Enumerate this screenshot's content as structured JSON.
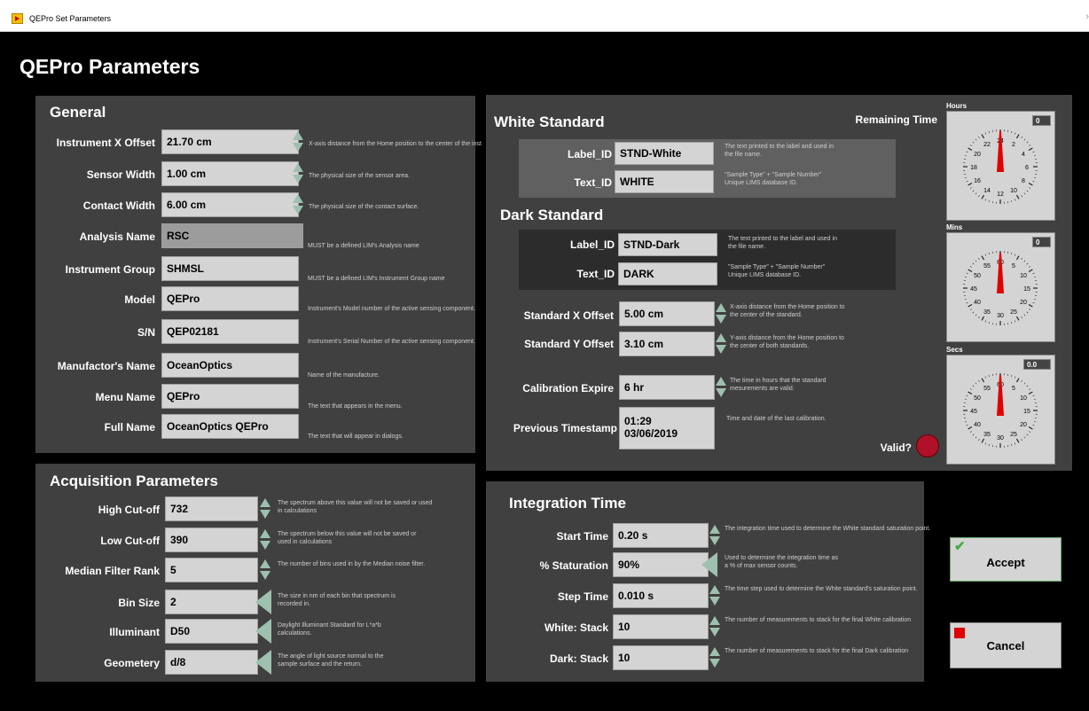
{
  "window": {
    "title": "QEPro Set Parameters",
    "chevron": "›"
  },
  "page_title": "QEPro Parameters",
  "general": {
    "title": "General",
    "fields": [
      {
        "label": "Instrument X Offset",
        "value": "21.70 cm",
        "desc": "X-axis distance from the Home position to the center of the inst"
      },
      {
        "label": "Sensor Width",
        "value": "1.00 cm",
        "desc": "The physical size of the sensor area."
      },
      {
        "label": "Contact Width",
        "value": "6.00 cm",
        "desc": "The physical size of the contact surface."
      },
      {
        "label": "Analysis Name",
        "value": "RSC",
        "desc": "MUST be a defined LIM's Analysis name"
      },
      {
        "label": "Instrument Group",
        "value": "SHMSL",
        "desc": "MUST be a defined LIM's Instrument Group name"
      },
      {
        "label": "Model",
        "value": "QEPro",
        "desc": "Instrument's Model number of the active sensing component."
      },
      {
        "label": "S/N",
        "value": "QEP02181",
        "desc": "Instrument's Serial Number of the active sensing component."
      },
      {
        "label": "Manufactor's Name",
        "value": "OceanOptics",
        "desc": "Name of the manufacture."
      },
      {
        "label": "Menu Name",
        "value": "QEPro",
        "desc": "The text that appears in the menu."
      },
      {
        "label": "Full Name",
        "value": "OceanOptics QEPro",
        "desc": "The text that will appear in dialogs."
      }
    ]
  },
  "acquisition": {
    "title": "Acquisition Parameters",
    "fields": [
      {
        "label": "High Cut-off",
        "value": "732",
        "desc1": "The spectrum above this value will not be saved or used",
        "desc2": "in calculations"
      },
      {
        "label": "Low Cut-off",
        "value": "390",
        "desc1": "The spectrum below this value will not be saved or",
        "desc2": "used in calculations"
      },
      {
        "label": "Median Filter Rank",
        "value": "5",
        "desc1": "The number of bins used in by the  Median noise filter.",
        "desc2": ""
      },
      {
        "label": "Bin Size",
        "value": "2",
        "desc1": "The size in nm of each bin that spectrum is",
        "desc2": "recorded in."
      },
      {
        "label": "Illuminant",
        "value": "D50",
        "desc1": "Daylight Illuminant Standard for L*a*b",
        "desc2": "calculations."
      },
      {
        "label": "Geometery",
        "value": "d/8",
        "desc1": "The angle of light source normal to the",
        "desc2": "sample surface and the return."
      }
    ]
  },
  "standards": {
    "white_title": "White Standard",
    "dark_title": "Dark Standard",
    "remaining_time": "Remaining Time",
    "white": {
      "label_id_label": "Label_ID",
      "label_id": "STND-White",
      "label_desc1": "The text printed to the label and used in",
      "label_desc2": "the file name.",
      "text_id_label": "Text_ID",
      "text_id": "WHITE",
      "text_desc1": "\"Sample Type\" + \"Sample Number\"",
      "text_desc2": "Unique LIMS database ID."
    },
    "dark": {
      "label_id_label": "Label_ID",
      "label_id": "STND-Dark",
      "label_desc1": "The text printed to the label and used in",
      "label_desc2": "the file name.",
      "text_id_label": "Text_ID",
      "text_id": "DARK",
      "text_desc1": "\"Sample Type\" + \"Sample Number\"",
      "text_desc2": "Unique LIMS database ID."
    },
    "std_x": {
      "label": "Standard X Offset",
      "value": "5.00 cm",
      "desc1": "X-axis distance from the Home position to",
      "desc2": "the center of the standard."
    },
    "std_y": {
      "label": "Standard Y Offset",
      "value": "3.10 cm",
      "desc1": "Y-axis distance from the Home position to",
      "desc2": "the center of both standards."
    },
    "cal_expire": {
      "label": "Calibration Expire",
      "value": "6 hr",
      "desc1": "The time in hours that the standard",
      "desc2": "mesurements are valid."
    },
    "prev_ts": {
      "label": "Previous Timestamp",
      "time": "01:29",
      "date": "03/06/2019",
      "desc": "Time and date of the last calibration."
    },
    "valid_label": "Valid?",
    "valid_color": "#b0102a"
  },
  "timers": {
    "hours": {
      "label": "Hours",
      "value": "0",
      "ticks": [
        "2",
        "4",
        "6",
        "8",
        "10",
        "12",
        "14",
        "16",
        "18",
        "20",
        "22",
        "24"
      ]
    },
    "mins": {
      "label": "Mins",
      "value": "0",
      "ticks": [
        "5",
        "10",
        "15",
        "20",
        "25",
        "30",
        "35",
        "40",
        "45",
        "50",
        "55",
        "60"
      ]
    },
    "secs": {
      "label": "Secs",
      "value": "0.0",
      "ticks": [
        "5",
        "10",
        "15",
        "20",
        "25",
        "30",
        "35",
        "40",
        "45",
        "50",
        "55",
        "60"
      ]
    }
  },
  "integration": {
    "title": "Integration Time",
    "fields": [
      {
        "label": "Start Time",
        "value": "0.20 s",
        "desc1": "The integration time used to determine the White standard saturation point.",
        "desc2": ""
      },
      {
        "label": "% Staturation",
        "value": "90%",
        "desc1": "Used to determine the integration time as",
        "desc2": "a % of max sensor  counts."
      },
      {
        "label": "Step Time",
        "value": "0.010 s",
        "desc1": "The time step used to determine the White standard's saturation point.",
        "desc2": ""
      },
      {
        "label": "White: Stack",
        "value": "10",
        "desc1": "The number of measurements to stack for the final White calibration",
        "desc2": ""
      },
      {
        "label": "Dark: Stack",
        "value": "10",
        "desc1": "The number of measurements to stack for the final Dark calibration",
        "desc2": ""
      }
    ]
  },
  "buttons": {
    "accept": "Accept",
    "cancel": "Cancel"
  },
  "colors": {
    "background": "#000000",
    "panel": "#404040",
    "field": "#d4d4d4",
    "gauge_needle": "#e00000",
    "spin_arrow": "#9ec0ae"
  }
}
